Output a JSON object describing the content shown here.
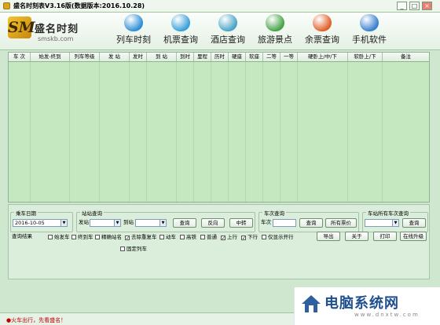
{
  "window": {
    "title": "盛名时刻表V3.16版(数据版本:2016.10.28)",
    "minimize": "_",
    "maximize": "□",
    "close": "×"
  },
  "logo": {
    "text": "盛名时刻",
    "url": "smskb.com"
  },
  "nav": [
    {
      "label": "列车时刻",
      "icon": "train-icon",
      "color": "#2e8fd6"
    },
    {
      "label": "机票查询",
      "icon": "airplane-icon",
      "color": "#3aa0d8"
    },
    {
      "label": "酒店查询",
      "icon": "hotel-icon",
      "color": "#4aa4c8"
    },
    {
      "label": "旅游景点",
      "icon": "landscape-icon",
      "color": "#47a34a"
    },
    {
      "label": "余票查询",
      "icon": "windows-icon",
      "color": "#e0602a"
    },
    {
      "label": "手机软件",
      "icon": "globe-icon",
      "color": "#3a7fd0"
    }
  ],
  "table": {
    "columns": [
      "车 次",
      "始发-终到",
      "列车等级",
      "发 站",
      "发时",
      "到 站",
      "到时",
      "里程",
      "历时",
      "硬座",
      "软座",
      "二等",
      "一等",
      "硬卧上/中/下",
      "软卧上/下",
      "备注"
    ],
    "rows": []
  },
  "query": {
    "date_group": "乘车日期",
    "date_value": "2016-10-05",
    "station_group": "站站查询",
    "from_label": "发站",
    "from_value": "",
    "to_label": "到站",
    "to_value": "",
    "query_btn": "查询",
    "reverse_btn": "反向",
    "transfer_btn": "中转",
    "train_group": "车次查询",
    "train_label": "车次",
    "train_value": "",
    "train_query_btn": "查询",
    "all_price_btn": "所有票价",
    "station_all_group": "车站所有车次查询",
    "station_all_value": "",
    "station_all_btn": "查询"
  },
  "results": {
    "label": "查询结果",
    "options": [
      {
        "label": "始发车",
        "checked": false
      },
      {
        "label": "终到车",
        "checked": false
      },
      {
        "label": "精确站名",
        "checked": false
      },
      {
        "label": "去除重复车",
        "checked": true
      },
      {
        "label": "动车",
        "checked": false
      },
      {
        "label": "高铁",
        "checked": false
      },
      {
        "label": "普通",
        "checked": false
      },
      {
        "label": "上行",
        "checked": true
      },
      {
        "label": "下行",
        "checked": true
      },
      {
        "label": "仅显示开行",
        "checked": false
      }
    ],
    "fixed": {
      "label": "固定列车",
      "checked": false
    }
  },
  "actions": {
    "export": "导出",
    "about": "关于",
    "print": "打印",
    "upgrade": "在线升级"
  },
  "status": {
    "text": "●火车出行，先看盛名！"
  },
  "watermark": {
    "text": "电脑系统网",
    "url": "www.dnxtw.com"
  }
}
